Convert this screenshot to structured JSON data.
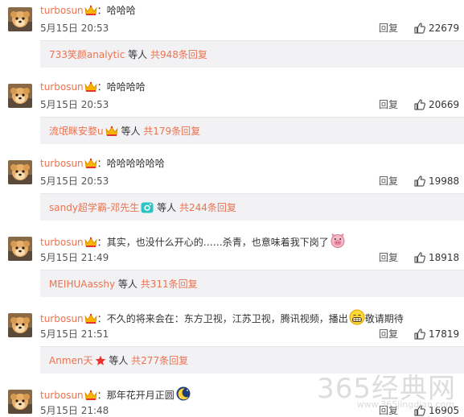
{
  "comments": [
    {
      "user": "turbosun",
      "separator": "：",
      "text": "哈哈哈",
      "time": "5月15日 20:53",
      "reply_label": "回复",
      "likes": "22679",
      "sub": {
        "user": "733笑颜analytic",
        "etc": "等人",
        "total": "共948条回复"
      }
    },
    {
      "user": "turbosun",
      "separator": "：",
      "text": "哈哈哈哈",
      "time": "5月15日 20:53",
      "reply_label": "回复",
      "likes": "20669",
      "sub": {
        "user": "流氓眯安婺u",
        "etc": "等人",
        "total": "共179条回复"
      }
    },
    {
      "user": "turbosun",
      "separator": "：",
      "text": "哈哈哈哈哈哈",
      "time": "5月15日 20:53",
      "reply_label": "回复",
      "likes": "19988",
      "sub": {
        "user": "sandy超学霸-邓先生",
        "etc": "等人",
        "total": "共244条回复"
      }
    },
    {
      "user": "turbosun",
      "separator": "：",
      "text": "其实，也没什么开心的……杀青，也意味着我下岗了",
      "time": "5月15日 21:49",
      "reply_label": "回复",
      "likes": "18918",
      "sub": {
        "user": "MEIHUAasshy",
        "etc": "等人",
        "total": "共311条回复"
      }
    },
    {
      "user": "turbosun",
      "separator": "：",
      "text": "不久的将来会在：东方卫视，江苏卫视，腾讯视频，播出",
      "text_after": "敬请期待",
      "time": "5月15日 21:51",
      "reply_label": "回复",
      "likes": "17819",
      "sub": {
        "user": "Anmen天",
        "etc": "等人",
        "total": "共277条回复"
      }
    },
    {
      "user": "turbosun",
      "separator": "：",
      "text": "那年花开月正圆",
      "time": "5月15日 21:48",
      "reply_label": "回复",
      "likes": "16905"
    }
  ],
  "watermark": {
    "main": "365经典网",
    "sub": "www.365jingdian.com"
  },
  "colors": {
    "username": "#eb7350",
    "sub_bg": "#f2f2f5",
    "text": "#333333"
  },
  "icons": {
    "avatar": "dog-avatar-icon",
    "vip": "vip-crown-badge-icon",
    "like": "thumbs-up-icon",
    "emoji_pig": "pig-face-icon",
    "emoji_grin": "grin-icon",
    "emoji_moon": "moon-icon",
    "badge_camera": "camera-badge-icon",
    "badge_star": "red-star-icon"
  }
}
